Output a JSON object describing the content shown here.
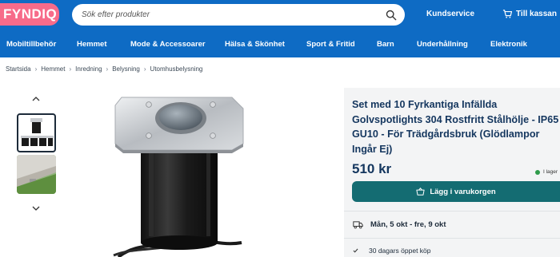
{
  "header": {
    "logo": "FYNDIQ",
    "search_placeholder": "Sök efter produkter",
    "kundservice": "Kundservice",
    "cart": "Till kassan"
  },
  "categories": [
    "Mobiltillbehör",
    "Hemmet",
    "Mode & Accessoarer",
    "Hälsa & Skönhet",
    "Sport & Fritid",
    "Barn",
    "Underhållning",
    "Elektronik"
  ],
  "breadcrumb": [
    "Startsida",
    "Hemmet",
    "Inredning",
    "Belysning",
    "Utomhusbelysning"
  ],
  "product": {
    "title": "Set med 10 Fyrkantiga Infällda Golvspotlights 304 Rostfritt Stålhölje - IP65 GU10 - För Trädgårdsbruk (Glödlampor Ingår Ej)",
    "price": "510 kr",
    "stock": "I lager",
    "buy_label": "Lägg i varukorgen",
    "delivery": "Mån, 5 okt - fre, 9 okt",
    "returns": "30 dagars öppet köp"
  },
  "icons": {
    "search": "search-icon",
    "cart": "cart-icon",
    "delivery": "truck-icon",
    "returns": "check-icon"
  },
  "colors": {
    "header_blue": "#0e6bc4",
    "logo_pink": "#f76b8a",
    "title_navy": "#14365e",
    "buy_teal": "#146c72",
    "stock_green": "#2e9b4a"
  }
}
